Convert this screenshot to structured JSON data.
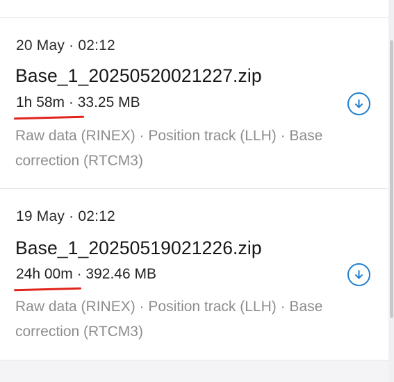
{
  "files": [
    {
      "date_time": "20 May · 02:12",
      "name": "Base_1_20250520021227.zip",
      "duration": "1h 58m",
      "separator": " · ",
      "size": "33.25 MB",
      "description": "Raw data (RINEX) · Position track (LLH) · Base correction (RTCM3)",
      "download_icon": "download-arrow-icon"
    },
    {
      "date_time": "19 May · 02:12",
      "name": "Base_1_20250519021226.zip",
      "duration": "24h 00m",
      "separator": " · ",
      "size": "392.46 MB",
      "description": "Raw data (RINEX) · Position track (LLH) · Base correction (RTCM3)",
      "download_icon": "download-arrow-icon"
    }
  ],
  "colors": {
    "accent": "#1f7ed0",
    "annotation": "#e0231b",
    "secondary_text": "#8d8d8d"
  }
}
